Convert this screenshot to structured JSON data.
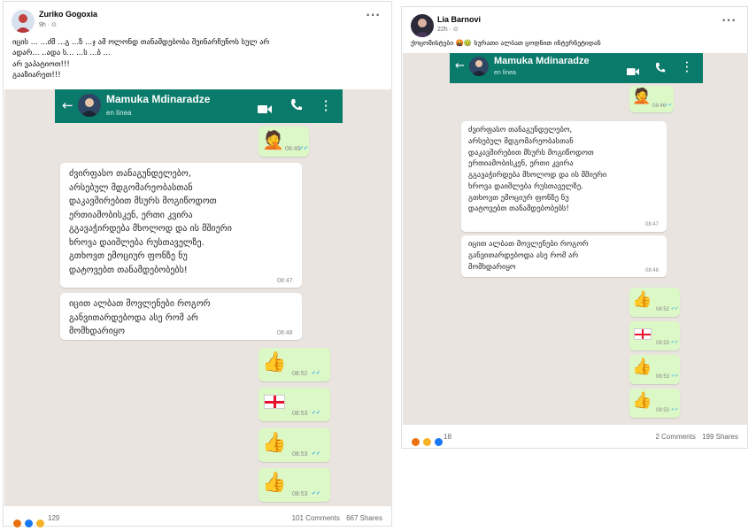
{
  "left_post": {
    "author": "Zuriko Gogoxia",
    "time": "9h · ⊙",
    "caption_lines": [
      "იცის ... ...ძმ ...გ ...ზ ...ჯ ამ ოლონდ თანამდებობა შეინარჩუნოს სულ არ",
      "ადარ... ..ადა ს... ...ს ...ბ ...",
      "არ ვაპატიოთ!!!",
      "გააზიარეთ!!!"
    ],
    "reaction_count": "129",
    "comments": "101 Comments",
    "shares": "667 Shares"
  },
  "right_post": {
    "author": "Lia Barnovi",
    "time": "22h · ⊙",
    "caption": "ქოცოშისტები 🤬🤢 სურათი ალბათ ცოდნით ინტერნეტიდან",
    "reaction_count": "18",
    "comments": "2 Comments",
    "shares": "199 Shares"
  },
  "chat": {
    "contact_name": "Mamuka Mdinaradze",
    "status": "en línea",
    "msg1_time": "08:46",
    "msg2_lines": [
      "ძვირფასო თანაგუნდელებო,",
      "არსებულ მდგომარეობასთან",
      "დაკავშირებით მსურს მოგიწოდოთ",
      "ერთიამობისკენ, ერთი კვირა",
      "გგავაჭირდება მხოლოდ და ის მშიერი",
      "ხროვა დაიშლება რუსთაველზე.",
      "გთხოვთ ემოციურ ფონზე ნუ",
      "დატოვებთ თანამდებობებს!"
    ],
    "msg2_time": "08:47",
    "msg3_lines": [
      "იცით ალბათ მოვლენები როგორ",
      "განვითარდებოდა ასე რომ არ",
      "მომხდარიყო"
    ],
    "msg3_time": "08:48",
    "out_times": [
      "08:52",
      "08:53",
      "08:53",
      "08:53"
    ],
    "ticks": "✔✔"
  },
  "icons": {
    "more": "···",
    "back": "←",
    "thumbs_up": "👍",
    "facepalm": "🤦"
  },
  "colors": {
    "whatsapp_header": "#0a7a6b",
    "outgoing_bubble": "#dcf8c6",
    "chat_bg": "#e9e4df",
    "read_ticks": "#4fb6ec"
  }
}
